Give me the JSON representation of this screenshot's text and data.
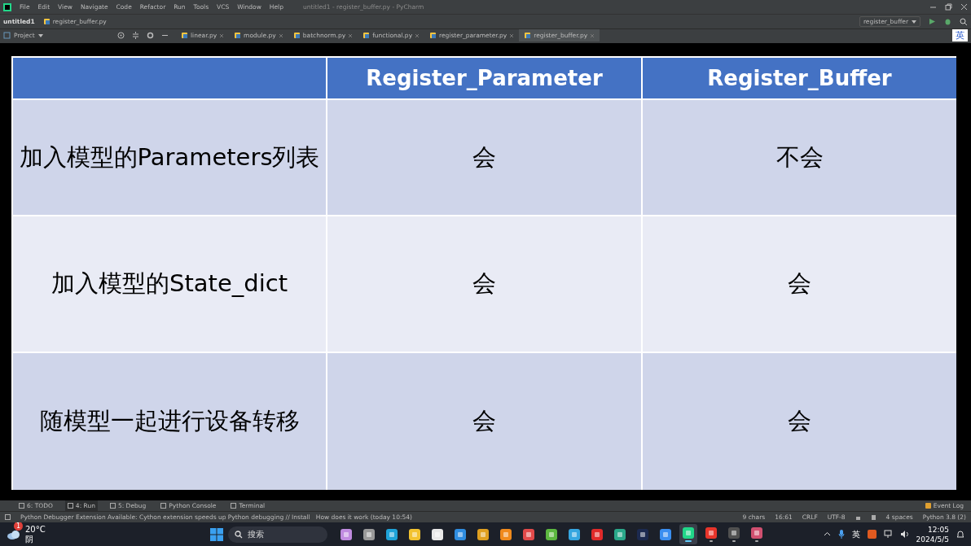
{
  "menu": [
    "File",
    "Edit",
    "View",
    "Navigate",
    "Code",
    "Refactor",
    "Run",
    "Tools",
    "VCS",
    "Window",
    "Help"
  ],
  "window_title": "untitled1 - register_buffer.py - PyCharm",
  "breadcrumbs": [
    "untitled1",
    "register_buffer.py"
  ],
  "run_config": "register_buffer",
  "ime_language": "英",
  "project_panel": "Project",
  "editor_tabs": [
    {
      "label": "linear.py",
      "selected": false
    },
    {
      "label": "module.py",
      "selected": false
    },
    {
      "label": "batchnorm.py",
      "selected": false
    },
    {
      "label": "functional.py",
      "selected": false
    },
    {
      "label": "register_parameter.py",
      "selected": false
    },
    {
      "label": "register_buffer.py",
      "selected": true
    }
  ],
  "table": {
    "header": [
      "Register_Parameter",
      "Register_Buffer"
    ],
    "rows": [
      {
        "label": "加入模型的Parameters列表",
        "cells": [
          "会",
          "不会"
        ]
      },
      {
        "label": "加入模型的State_dict",
        "cells": [
          "会",
          "会"
        ]
      },
      {
        "label": "随模型一起进行设备转移",
        "cells": [
          "会",
          "会"
        ]
      }
    ]
  },
  "tool_windows": [
    {
      "label": "6: TODO",
      "selected": false
    },
    {
      "label": "4: Run",
      "selected": true
    },
    {
      "label": "5: Debug",
      "selected": false
    },
    {
      "label": "Python Console",
      "selected": false
    },
    {
      "label": "Terminal",
      "selected": false
    }
  ],
  "event_log": "Event Log",
  "status_message": "Python Debugger Extension Available: Cython extension speeds up Python debugging // Install   How does it work (today 10:54)",
  "status_items": [
    "9 chars",
    "16:61",
    "CRLF",
    "UTF-8",
    "4 spaces",
    "Python 3.8 (2)"
  ],
  "taskbar": {
    "weather_badge": "1",
    "temperature": "20°C",
    "condition": "阴",
    "search_placeholder": "搜索",
    "apps": [
      {
        "color": "#c08be0",
        "running": false,
        "selected": false
      },
      {
        "color": "#9a9a9a",
        "running": false,
        "selected": false
      },
      {
        "color": "#1fa3d8",
        "running": false,
        "selected": false
      },
      {
        "color": "#f2c230",
        "running": false,
        "selected": false
      },
      {
        "color": "#e8e8e8",
        "running": false,
        "selected": false
      },
      {
        "color": "#2f8de0",
        "running": false,
        "selected": false
      },
      {
        "color": "#e0a020",
        "running": false,
        "selected": false
      },
      {
        "color": "#f08a1c",
        "running": false,
        "selected": false
      },
      {
        "color": "#e24a4a",
        "running": false,
        "selected": false
      },
      {
        "color": "#5cb840",
        "running": false,
        "selected": false
      },
      {
        "color": "#36a6e0",
        "running": false,
        "selected": false
      },
      {
        "color": "#e02a2a",
        "running": false,
        "selected": false
      },
      {
        "color": "#2aa88a",
        "running": false,
        "selected": false
      },
      {
        "color": "#1c2a50",
        "running": false,
        "selected": false
      },
      {
        "color": "#3a8ef0",
        "running": false,
        "selected": false
      },
      {
        "color": "#21d789",
        "running": true,
        "selected": true
      },
      {
        "color": "#e8352b",
        "running": true,
        "selected": false
      },
      {
        "color": "#505050",
        "running": true,
        "selected": false
      },
      {
        "color": "#d05070",
        "running": true,
        "selected": false
      }
    ],
    "tray_language": "英",
    "time": "12:05",
    "date": "2024/5/5"
  }
}
